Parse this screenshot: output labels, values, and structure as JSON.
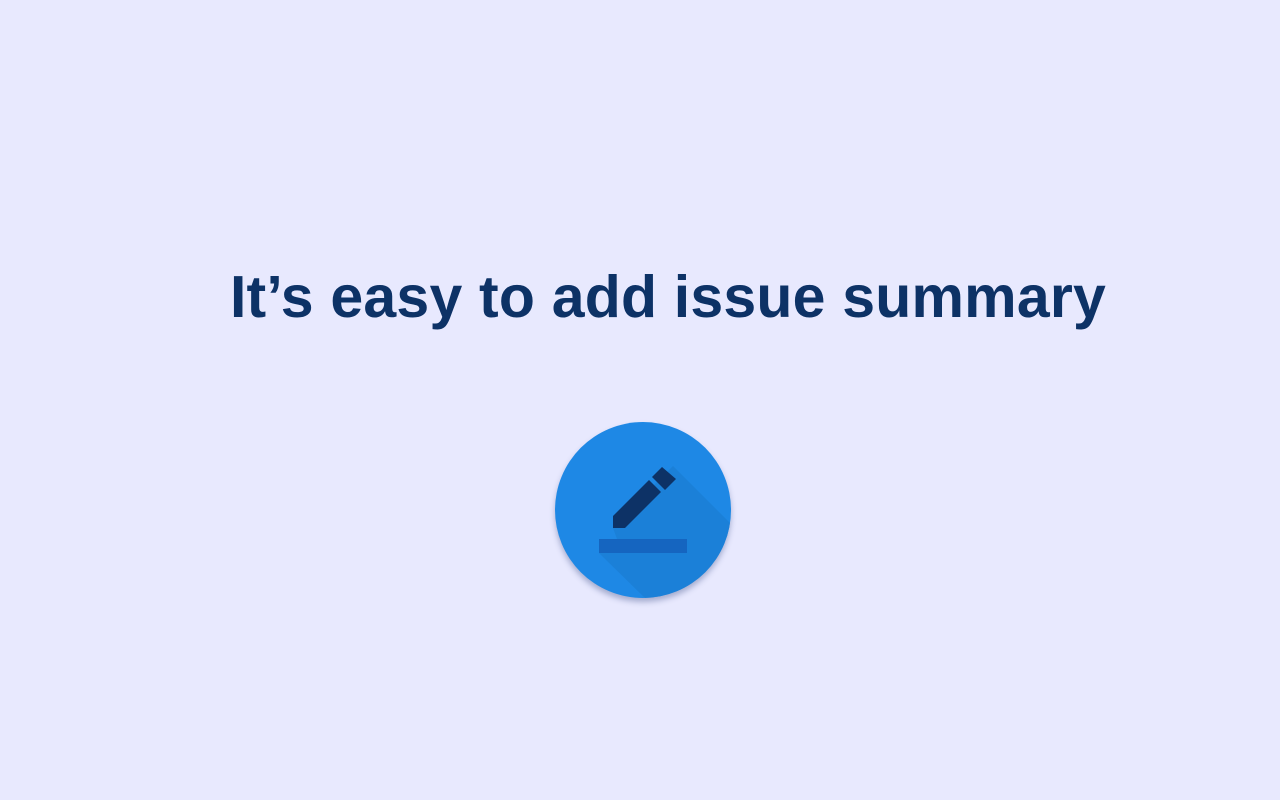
{
  "headline": "It’s easy to add issue summary",
  "icon": {
    "name": "edit-pencil-icon",
    "colors": {
      "circle": "#1e88e5",
      "pencil": "#0d3266",
      "underline": "#1565c0",
      "long_shadow": "#1b7fd6"
    }
  },
  "colors": {
    "background": "#e8e9fe",
    "headline": "#0d3266"
  }
}
